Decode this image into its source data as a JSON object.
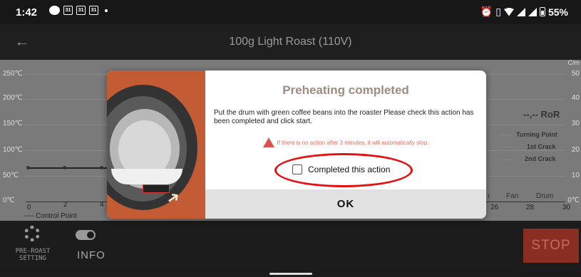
{
  "status_bar": {
    "time": "1:42",
    "calendar_day": "31",
    "battery": "55%",
    "icons": [
      "message-icon",
      "calendar-icon",
      "calendar-icon",
      "calendar-icon",
      "dot-icon",
      "alarm-icon",
      "vibrate-icon",
      "wifi-icon",
      "signal-icon",
      "signal-icon",
      "battery-icon"
    ]
  },
  "app_bar": {
    "title": "100g Light Roast (110V)"
  },
  "chart": {
    "y_left": [
      "250℃",
      "200℃",
      "150℃",
      "100℃",
      "50℃",
      "0℃"
    ],
    "y_right": [
      "50",
      "40",
      "30",
      "20",
      "10",
      "0℃"
    ],
    "x_ticks": [
      "0",
      "2",
      "4",
      "26",
      "28",
      "30"
    ],
    "control_point_legend": "---- Control Point",
    "ror_label": "--,-- RoR",
    "legend": {
      "turning_point": "Turning Point",
      "first_crack": "1st Crack",
      "second_crack": "2nd Crack"
    },
    "bottom_labels": {
      "partial": "r",
      "fan": "Fan",
      "drum": "Drum"
    },
    "right_partial": "C/m"
  },
  "toolbar": {
    "pre_roast_label": "PRE-ROAST SETTING",
    "info_label": "INFO",
    "stop_label": "STOP"
  },
  "dialog": {
    "title": "Preheating completed",
    "message": "Put the drum with green coffee beans into the roaster Please check this action has been completed and click start.",
    "warning": "If there is no action after 3 minutes, it will automatically stop.",
    "checkbox_label": "Completed this action",
    "checkbox_checked": false,
    "ok_label": "OK"
  },
  "colors": {
    "stop_button": "#8a2d22",
    "illustration_bg": "#c35b34",
    "title": "#9e8c80",
    "warning": "#e06b61",
    "highlight": "#e61010"
  }
}
